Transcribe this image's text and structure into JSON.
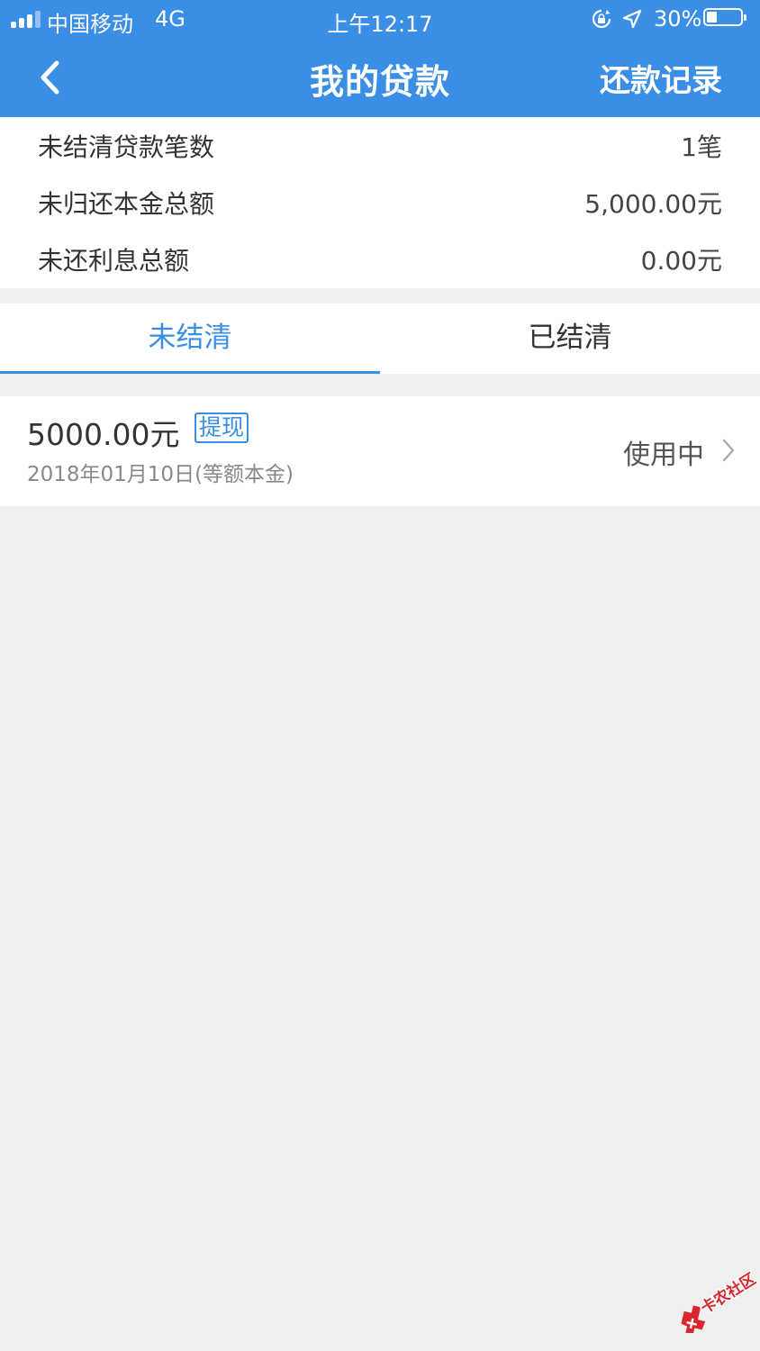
{
  "status_bar": {
    "carrier": "中国移动",
    "network": "4G",
    "time": "上午12:17",
    "battery_percent": "30%",
    "battery_level": 0.3,
    "icons": [
      "signal-icon",
      "orientation-lock-icon",
      "location-arrow-icon",
      "battery-icon"
    ]
  },
  "nav": {
    "back_icon": "chevron-left-icon",
    "title": "我的贷款",
    "right_action": "还款记录"
  },
  "summary": [
    {
      "label": "未结清贷款笔数",
      "value": "1笔"
    },
    {
      "label": "未归还本金总额",
      "value": "5,000.00元"
    },
    {
      "label": "未还利息总额",
      "value": "0.00元"
    }
  ],
  "tabs": [
    {
      "label": "未结清",
      "active": true
    },
    {
      "label": "已结清",
      "active": false
    }
  ],
  "loans": [
    {
      "amount": "5000.00元",
      "tag": "提现",
      "date": "2018年01月10日(等额本金)",
      "status": "使用中"
    }
  ],
  "watermark": "卡农社区",
  "colors": {
    "primary": "#3a8ee6",
    "background": "#efeff0",
    "watermark_red": "#d9262c"
  }
}
